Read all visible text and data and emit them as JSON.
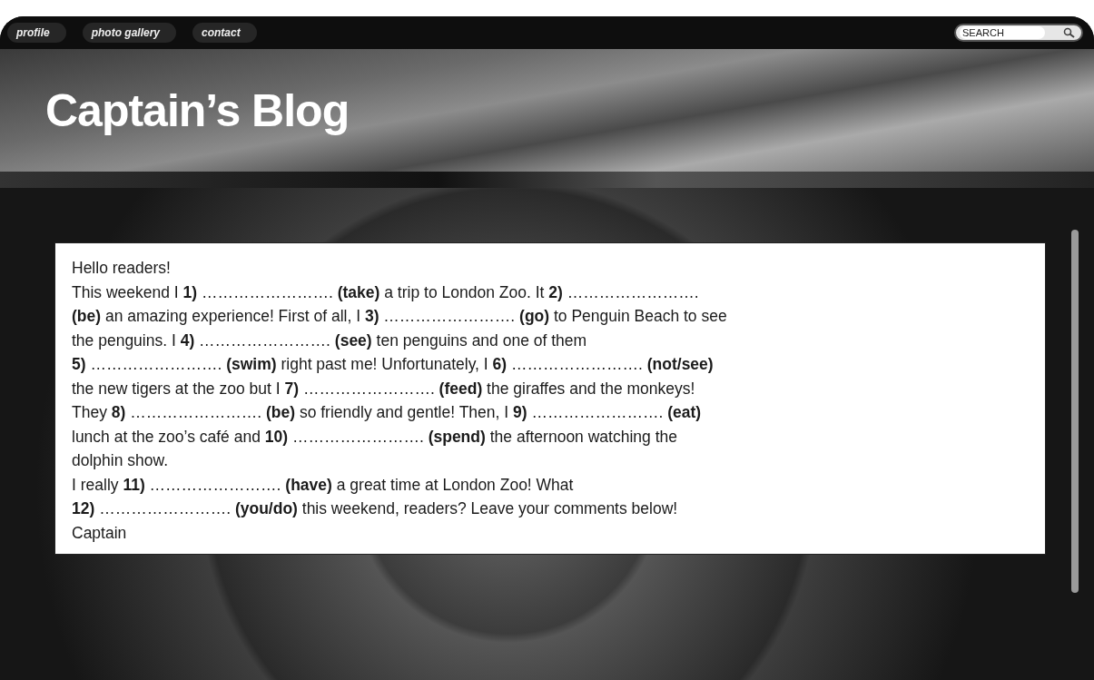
{
  "nav": [
    {
      "label": "profile"
    },
    {
      "label": "photo gallery"
    },
    {
      "label": "contact"
    }
  ],
  "search": {
    "placeholder": "SEARCH"
  },
  "title": "Captain’s Blog",
  "post_lines": [
    "Hello readers!",
    "This weekend I **1)** ……………………. **(take)** a trip to London Zoo. It **2)** …………………….",
    "**(be)** an amazing experience! First of all, I **3)** ……………………. **(go)** to Penguin Beach to see",
    "the penguins. I **4)** ……………………. **(see)** ten penguins and one of them",
    "**5)** ……………………. **(swim)** right past me! Unfortunately, I **6)** ……………………. **(not/see)**",
    "the new tigers at the zoo but I **7)** ……………………. **(feed)** the giraffes and the monkeys!",
    "They **8)** ……………………. **(be)** so friendly and gentle! Then, I **9)** ……………………. **(eat)**",
    "lunch at the zoo’s café and **10)** ……………………. **(spend)** the afternoon watching the",
    "dolphin show.",
    "I really **11)** ……………………. **(have)** a great time at London Zoo! What",
    "**12)** ……………………. **(you/do)** this weekend, readers? Leave your comments below!",
    "Captain"
  ]
}
